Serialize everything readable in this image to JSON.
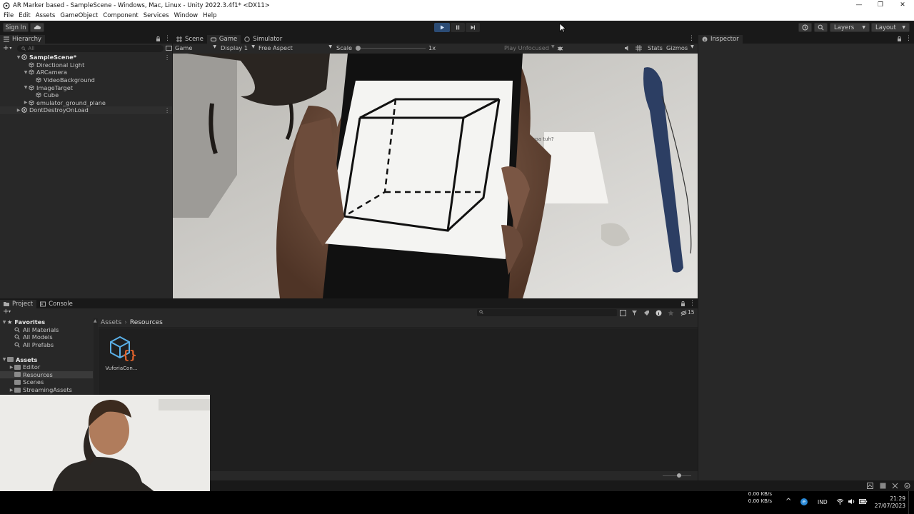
{
  "window": {
    "title": "AR Marker based - SampleScene - Windows, Mac, Linux - Unity 2022.3.4f1* <DX11>",
    "controls": [
      "—",
      "❐",
      "✕"
    ]
  },
  "menu": [
    "File",
    "Edit",
    "Assets",
    "GameObject",
    "Component",
    "Services",
    "Window",
    "Help"
  ],
  "toolbar": {
    "sign_in": "Sign In",
    "layers": "Layers",
    "layout": "Layout"
  },
  "hierarchy": {
    "tab": "Hierarchy",
    "search_placeholder": "All",
    "items": [
      {
        "label": "SampleScene*"
      },
      {
        "label": "Directional Light"
      },
      {
        "label": "ARCamera"
      },
      {
        "label": "VideoBackground"
      },
      {
        "label": "ImageTarget"
      },
      {
        "label": "Cube"
      },
      {
        "label": "emulator_ground_plane"
      },
      {
        "label": "DontDestroyOnLoad"
      }
    ]
  },
  "view_tabs": [
    "Scene",
    "Game",
    "Simulator"
  ],
  "game_toolbar": {
    "mode": "Game",
    "display": "Display 1",
    "aspect": "Free Aspect",
    "scale_label": "Scale",
    "scale_value": "1x",
    "play_focus": "Play Unfocused",
    "stats": "Stats",
    "gizmos": "Gizmos"
  },
  "game_view": {
    "paper_text": "Kenapa tuh?"
  },
  "inspector": {
    "tab": "Inspector"
  },
  "bottom_tabs": [
    "Project",
    "Console"
  ],
  "project": {
    "favorites_label": "Favorites",
    "favorites": [
      "All Materials",
      "All Models",
      "All Prefabs"
    ],
    "assets_label": "Assets",
    "assets": [
      "Editor",
      "Resources",
      "Scenes",
      "StreamingAssets"
    ],
    "breadcrumb": [
      "Assets",
      "Resources"
    ],
    "hidden_count": "15",
    "files": [
      {
        "name": "VuforiaCon..."
      }
    ]
  },
  "taskbar": {
    "net_up": "0.00 KB/s",
    "net_down": "0.00 KB/s",
    "lang": "IND",
    "time": "21:29",
    "date": "27/07/2023"
  },
  "colors": {
    "play_active": "#2b4b74",
    "folder_selected": "#3a3a3a",
    "accent_blue": "#5ab0e8",
    "vuforia_orange": "#e0622b"
  }
}
